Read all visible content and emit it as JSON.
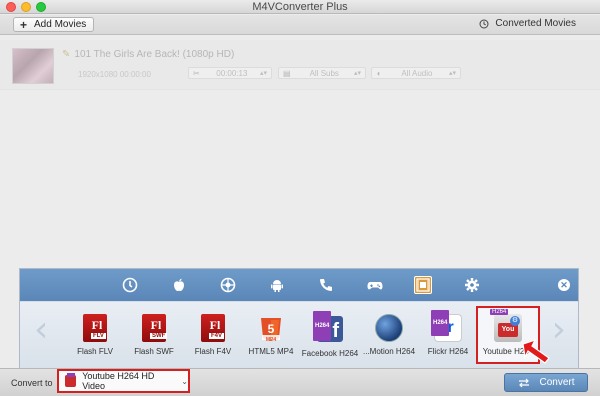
{
  "window": {
    "title": "M4VConverter Plus"
  },
  "toolbar": {
    "add_label": "Add Movies",
    "converted_label": "Converted Movies"
  },
  "movie": {
    "title": "101 The Girls Are Back! (1080p HD)",
    "meta": "1920x1080  00:00:00",
    "time_value": "00:00:13",
    "subtitle_value": "All Subs",
    "audio_value": "All Audio"
  },
  "categories": [
    {
      "icon": "clock-icon"
    },
    {
      "icon": "apple-icon"
    },
    {
      "icon": "playstation-icon"
    },
    {
      "icon": "android-icon"
    },
    {
      "icon": "phone-icon"
    },
    {
      "icon": "gamepad-icon"
    },
    {
      "icon": "film-icon",
      "active": true
    },
    {
      "icon": "gear-icon"
    }
  ],
  "formats": [
    {
      "label": "Flash FLV",
      "tag": "FLV"
    },
    {
      "label": "Flash SWF",
      "tag": "SWF"
    },
    {
      "label": "Flash F4V",
      "tag": "F4V"
    },
    {
      "label": "HTML5 MP4",
      "tag": "MP4"
    },
    {
      "label": "Facebook H264",
      "tag": "H264"
    },
    {
      "label": "...Motion H264",
      "tag": ""
    },
    {
      "label": "Flickr H264",
      "tag": "H264"
    },
    {
      "label": "Youtube H264",
      "tag": "H264",
      "selected": true
    }
  ],
  "bottom": {
    "convert_to_label": "Convert to",
    "selected_format": "Youtube H264 HD Video",
    "convert_button": "Convert"
  },
  "colors": {
    "accent": "#5a87b8",
    "highlight": "#d42020"
  }
}
